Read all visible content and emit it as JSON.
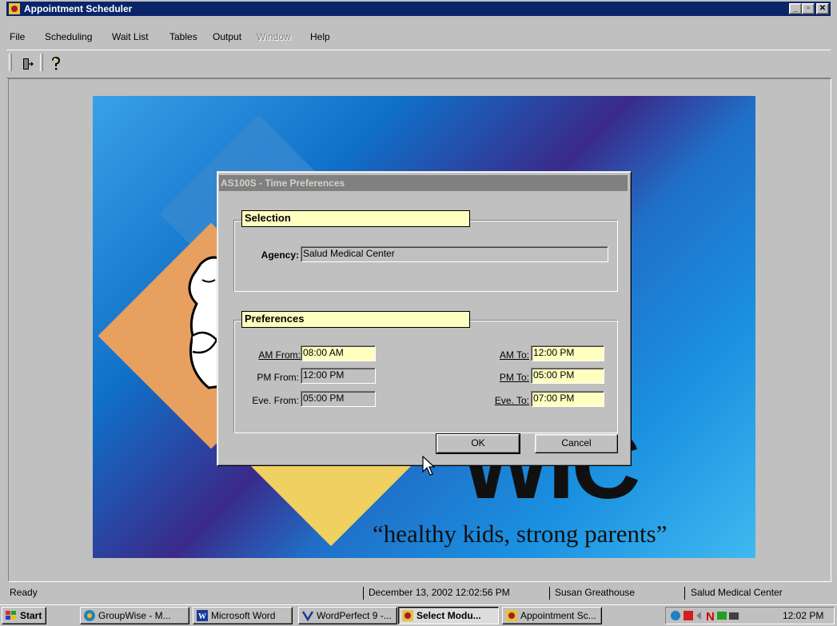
{
  "window": {
    "title": "Appointment Scheduler",
    "min": "_",
    "max": "▫",
    "close": "✕"
  },
  "menu": [
    "File",
    "Scheduling",
    "Wait List",
    "Tables",
    "Output",
    "Window",
    "Help"
  ],
  "menu_disabled_index": 5,
  "splash": {
    "logo_text": "WIC",
    "slogan": "“healthy kids, strong parents”"
  },
  "dialog": {
    "title": "AS100S - Time Preferences",
    "selection_label": "Selection",
    "agency_label": "Agency:",
    "agency_value": "Salud Medical Center",
    "preferences_label": "Preferences",
    "am_from_label": "AM From:",
    "am_from": "08:00 AM",
    "pm_from_label": "PM From:",
    "pm_from": "12:00 PM",
    "eve_from_label": "Eve. From:",
    "eve_from": "05:00 PM",
    "am_to_label": "AM To:",
    "am_to": "12:00 PM",
    "pm_to_label": "PM To:",
    "pm_to": "05:00 PM",
    "eve_to_label": "Eve. To:",
    "eve_to": "07:00 PM",
    "ok": "OK",
    "cancel": "Cancel"
  },
  "status": {
    "ready": "Ready",
    "datetime": "December 13, 2002 12:02:56 PM",
    "user": "Susan Greathouse",
    "agency": "Salud Medical Center"
  },
  "taskbar": {
    "start": "Start",
    "tasks": [
      "GroupWise - M...",
      "Microsoft Word",
      "WordPerfect 9 -...",
      "Select Modu...",
      "Appointment Sc..."
    ],
    "clock": "12:02 PM"
  },
  "colors": {
    "titlebar": "#0a246a",
    "field_yellow": "#ffffc0",
    "face": "#c0c0c0"
  }
}
